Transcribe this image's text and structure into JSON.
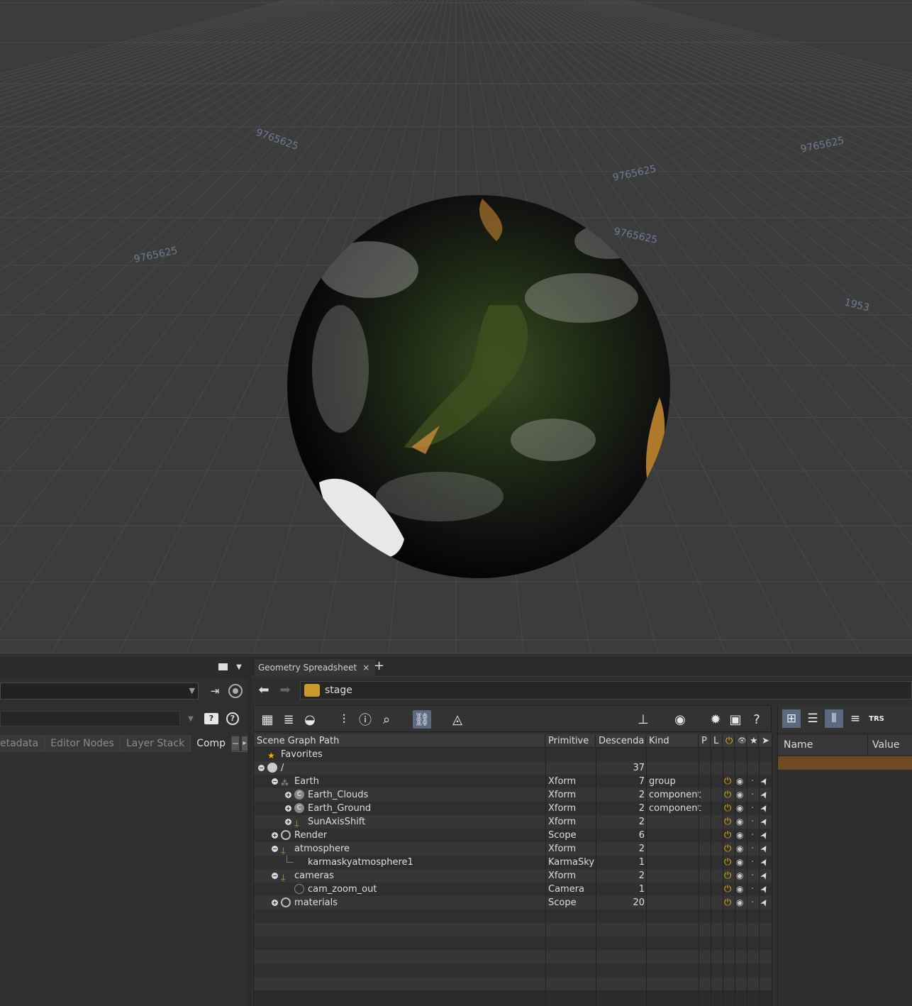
{
  "viewport": {
    "grid_labels": [
      "9765625",
      "9765625",
      "9765625",
      "9765625",
      "1953",
      "9765625"
    ]
  },
  "left_pane": {
    "tabs": [
      "etadata",
      "Editor Nodes",
      "Layer Stack",
      "Comp"
    ],
    "icons": [
      "layout-menu-icon",
      "pin-icon",
      "target-icon",
      "camera-help-icon",
      "help-icon"
    ]
  },
  "center_pane": {
    "tab_label": "Geometry Spreadsheet",
    "tab_close": "×",
    "new_tab": "+",
    "path": "stage",
    "columns": [
      "Scene Graph Path",
      "Primitive",
      "Descenda",
      "Kind",
      "P",
      "L",
      "⏻",
      "👁",
      "★",
      "➤"
    ],
    "rows": [
      {
        "indent": 0,
        "name": "Favorites",
        "icon": "favorites-icon",
        "prim": "",
        "desc": "",
        "kind": "",
        "flags": false
      },
      {
        "indent": 0,
        "name": "/",
        "icon": "root-icon",
        "prim": "",
        "desc": "37",
        "kind": "",
        "flags": false,
        "expand": "−"
      },
      {
        "indent": 1,
        "name": "Earth",
        "icon": "group-icon",
        "prim": "Xform",
        "desc": "7",
        "kind": "group",
        "flags": true,
        "expand": "−"
      },
      {
        "indent": 2,
        "name": "Earth_Clouds",
        "icon": "component-icon",
        "prim": "Xform",
        "desc": "2",
        "kind": "component",
        "flags": true,
        "expand": "+"
      },
      {
        "indent": 2,
        "name": "Earth_Ground",
        "icon": "component-icon",
        "prim": "Xform",
        "desc": "2",
        "kind": "component",
        "flags": true,
        "expand": "+"
      },
      {
        "indent": 2,
        "name": "SunAxisShift",
        "icon": "xform-icon",
        "prim": "Xform",
        "desc": "2",
        "kind": "",
        "flags": true,
        "expand": "+"
      },
      {
        "indent": 1,
        "name": "Render",
        "icon": "scope-icon",
        "prim": "Scope",
        "desc": "6",
        "kind": "",
        "flags": true,
        "expand": "+"
      },
      {
        "indent": 1,
        "name": "atmosphere",
        "icon": "xform-icon",
        "prim": "Xform",
        "desc": "2",
        "kind": "",
        "flags": true,
        "expand": "−"
      },
      {
        "indent": 2,
        "name": "karmaskyatmosphere1",
        "icon": "",
        "prim": "KarmaSky",
        "desc": "1",
        "kind": "",
        "flags": true
      },
      {
        "indent": 1,
        "name": "cameras",
        "icon": "xform-icon",
        "prim": "Xform",
        "desc": "2",
        "kind": "",
        "flags": true,
        "expand": "−"
      },
      {
        "indent": 2,
        "name": "cam_zoom_out",
        "icon": "camera-icon",
        "prim": "Camera",
        "desc": "1",
        "kind": "",
        "flags": true
      },
      {
        "indent": 1,
        "name": "materials",
        "icon": "scope-icon",
        "prim": "Scope",
        "desc": "20",
        "kind": "",
        "flags": true,
        "expand": "+"
      }
    ]
  },
  "right_pane": {
    "headers": [
      "Name",
      "Value"
    ],
    "toolbar_icons": [
      "tree-view-icon",
      "list-view-icon",
      "columns-view-icon",
      "rows-view-icon",
      "trs-icon"
    ]
  },
  "colors": {
    "accent_power": "#f2b600",
    "selection": "#6e4a22"
  }
}
